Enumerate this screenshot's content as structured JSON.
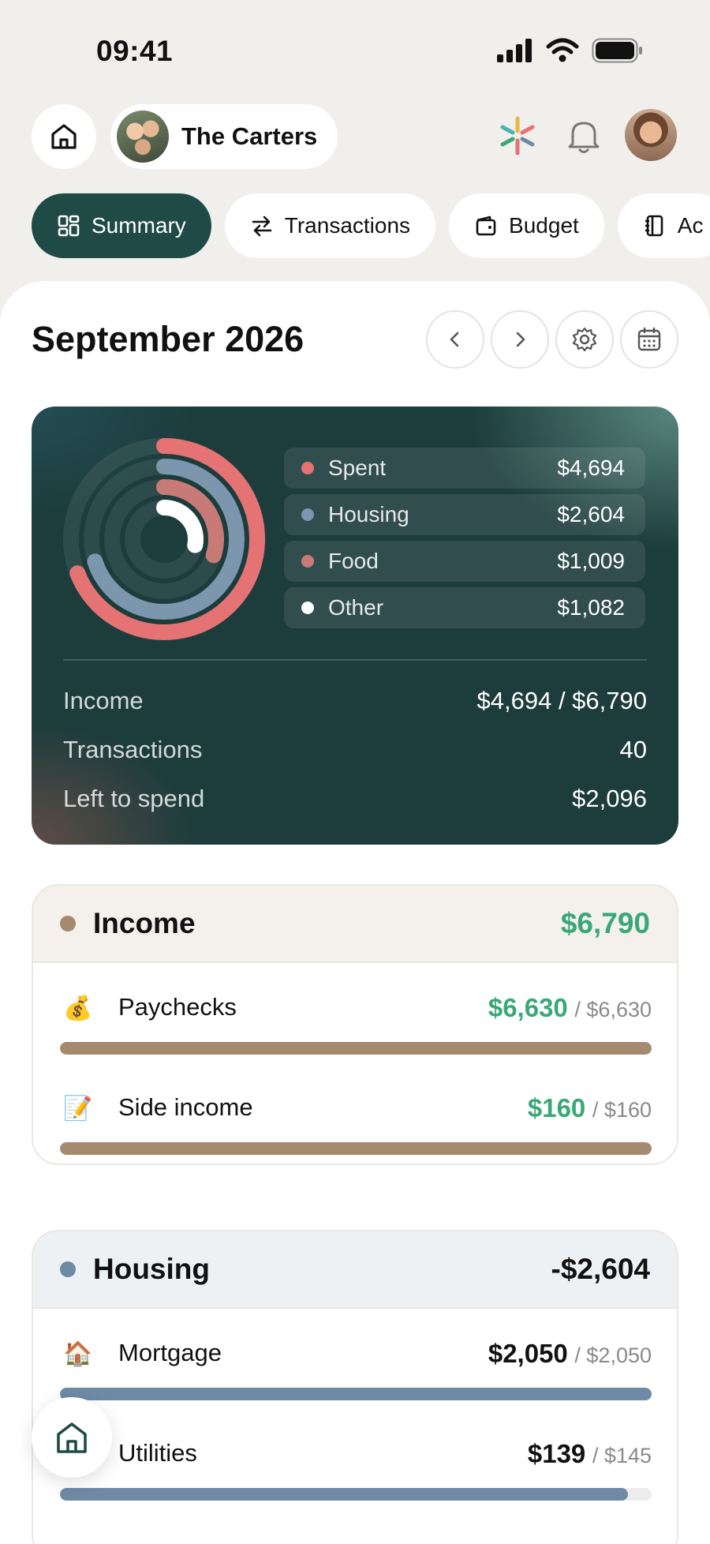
{
  "status_bar": {
    "time": "09:41"
  },
  "header": {
    "family_name": "The Carters"
  },
  "tabs": [
    {
      "label": "Summary",
      "active": true
    },
    {
      "label": "Transactions",
      "active": false
    },
    {
      "label": "Budget",
      "active": false
    },
    {
      "label": "Ac",
      "active": false
    }
  ],
  "month": {
    "title": "September 2026"
  },
  "summary": {
    "legend": [
      {
        "label": "Spent",
        "value": "$4,694",
        "color": "#e57373"
      },
      {
        "label": "Housing",
        "value": "$2,604",
        "color": "#7b96ad"
      },
      {
        "label": "Food",
        "value": "$1,009",
        "color": "#c87b76"
      },
      {
        "label": "Other",
        "value": "$1,082",
        "color": "#ffffff"
      }
    ],
    "rings": {
      "spent_fraction": 0.69,
      "housing_fraction": 0.7,
      "food_fraction": 0.3,
      "other_fraction": 0.28
    },
    "stats": [
      {
        "label": "Income",
        "value": "$4,694 / $6,790"
      },
      {
        "label": "Transactions",
        "value": "40"
      },
      {
        "label": "Left to spend",
        "value": "$2,096"
      }
    ]
  },
  "income": {
    "title": "Income",
    "total": "$6,790",
    "dot_color": "#a58a70",
    "head_bg": "#f4f0ec",
    "items": [
      {
        "icon": "money-bag-icon",
        "emoji": "💰",
        "name": "Paychecks",
        "amount": "$6,630",
        "budget": "/ $6,630",
        "progress": 1.0
      },
      {
        "icon": "memo-icon",
        "emoji": "📝",
        "name": "Side income",
        "amount": "$160",
        "budget": "/ $160",
        "progress": 1.0
      }
    ]
  },
  "housing": {
    "title": "Housing",
    "total": "-$2,604",
    "dot_color": "#6e8aa4",
    "head_bg": "#eef1f3",
    "items": [
      {
        "icon": "house-icon",
        "emoji": "🏠",
        "name": "Mortgage",
        "amount": "$2,050",
        "budget": "/ $2,050",
        "progress": 1.0
      },
      {
        "icon": "utilities-icon",
        "emoji": "💡",
        "name": "Utilities",
        "amount": "$139",
        "budget": "/ $145",
        "progress": 0.96
      }
    ]
  },
  "colors": {
    "accent": "#1f4a45",
    "income_green": "#3aa876",
    "income_bar": "#a58a70",
    "housing_bar": "#6e8aa4"
  }
}
